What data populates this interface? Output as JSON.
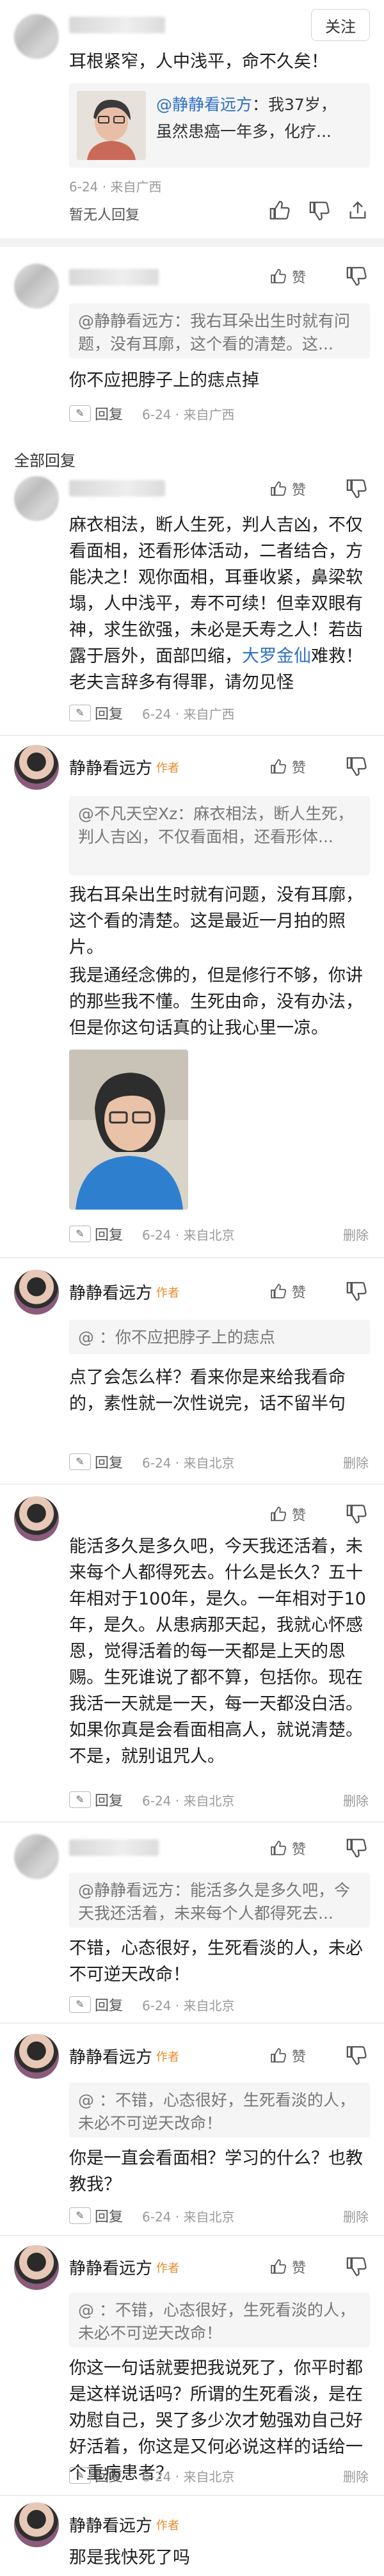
{
  "original": {
    "follow_label": "关注",
    "text": "耳根紧窄，人中浅平，命不久矣！",
    "quote": {
      "author": "@静静看远方",
      "line1": "：我37岁，",
      "line2": "虽然患癌一年多，化疗..."
    },
    "meta": "6-24 · 来自广西",
    "reply_label": "暂无人回复"
  },
  "card1": {
    "quote": "@静静看远方：我右耳朵出生时就有问题，没有耳廓，这个看的清楚。这...",
    "text": "你不应把脖子上的痣点掉",
    "reply_label": "回复",
    "meta": "6-24 · 来自广西",
    "like": "赞"
  },
  "section_label": "全部回复",
  "card2": {
    "text_a": "麻衣相法，断人生死，判人吉凶，不仅看面相，还看形体活动，二者结合，方能决之！观你面相，耳垂收紧，鼻梁软塌，人中浅平，寿不可续！但幸双眼有神，求生欲强，未必是夭寿之人！若齿露于唇外，面部凹缩，",
    "link": "大罗金仙",
    "link_tail": "难",
    "text_b": "救！老夫言辞多有得罪，请勿见怪",
    "reply_label": "回复",
    "meta": "6-24 · 来自广西",
    "like": "赞"
  },
  "card3": {
    "name": "静静看远方",
    "author_tag": "作者",
    "quote": "@不凡天空Xz：麻衣相法，断人生死，判人吉凶，不仅看面相，还看形体...",
    "text1": "我右耳朵出生时就有问题，没有耳廓，这个看的清楚。这是最近一月拍的照片。",
    "text2": "我是通经念佛的，但是修行不够，你讲的那些我不懂。生死由命，没有办法，但是你这句话真的让我心里一凉。",
    "reply_label": "回复",
    "meta": "6-24 · 来自北京",
    "like": "赞",
    "delete": "删除"
  },
  "card4": {
    "name": "静静看远方",
    "author_tag": "作者",
    "quote": "@       ：你不应把脖子上的痣点",
    "text": "点了会怎么样？看来你是来给我看命的，素性就一次性说完，话不留半句",
    "reply_label": "回复",
    "meta": "6-24 · 来自北京",
    "like": "赞",
    "delete": "删除"
  },
  "card5": {
    "text": "能活多久是多久吧，今天我还活着，未来每个人都得死去。什么是长久？五十年相对于100年，是久。一年相对于10年，是久。从患病那天起，我就心怀感恩，觉得活着的每一天都是上天的恩赐。生死谁说了都不算，包括你。现在我活一天就是一天，每一天都没白活。如果你真是会看面相高人，就说清楚。不是，就别诅咒人。",
    "reply_label": "回复",
    "meta": "6-24 · 来自北京",
    "like": "赞",
    "delete": "删除"
  },
  "card6": {
    "quote": "@静静看远方：能活多久是多久吧，今天我还活着，未来每个人都得死去...",
    "text": "不错，心态很好，生死看淡的人，未必不可逆天改命！",
    "reply_label": "回复",
    "meta": "6-24 · 来自北京",
    "like": "赞"
  },
  "card7": {
    "name": "静静看远方",
    "author_tag": "作者",
    "quote": "@       ：不错，心态很好，生死看淡的人，未必不可逆天改命！",
    "text": "你是一直会看面相？学习的什么？也教教我？",
    "reply_label": "回复",
    "meta": "6-24 · 来自北京",
    "like": "赞",
    "delete": "删除"
  },
  "card8": {
    "name": "静静看远方",
    "author_tag": "作者",
    "quote": "@       ：不错，心态很好，生死看淡的人，未必不可逆天改命！",
    "text": "你这一句话就要把我说死了，你平时都是这样说话吗？所谓的生死看淡，是在劝慰自己，哭了多少次才勉强劝自己好好活着，你这是又何必说这样的话给一个重病患者？",
    "reply_label": "回复",
    "meta": "6-24 · 来自北京",
    "like": "赞",
    "delete": "删除"
  },
  "card9": {
    "name": "静静看远方",
    "author_tag": "作者",
    "text": "那是我快死了吗"
  }
}
